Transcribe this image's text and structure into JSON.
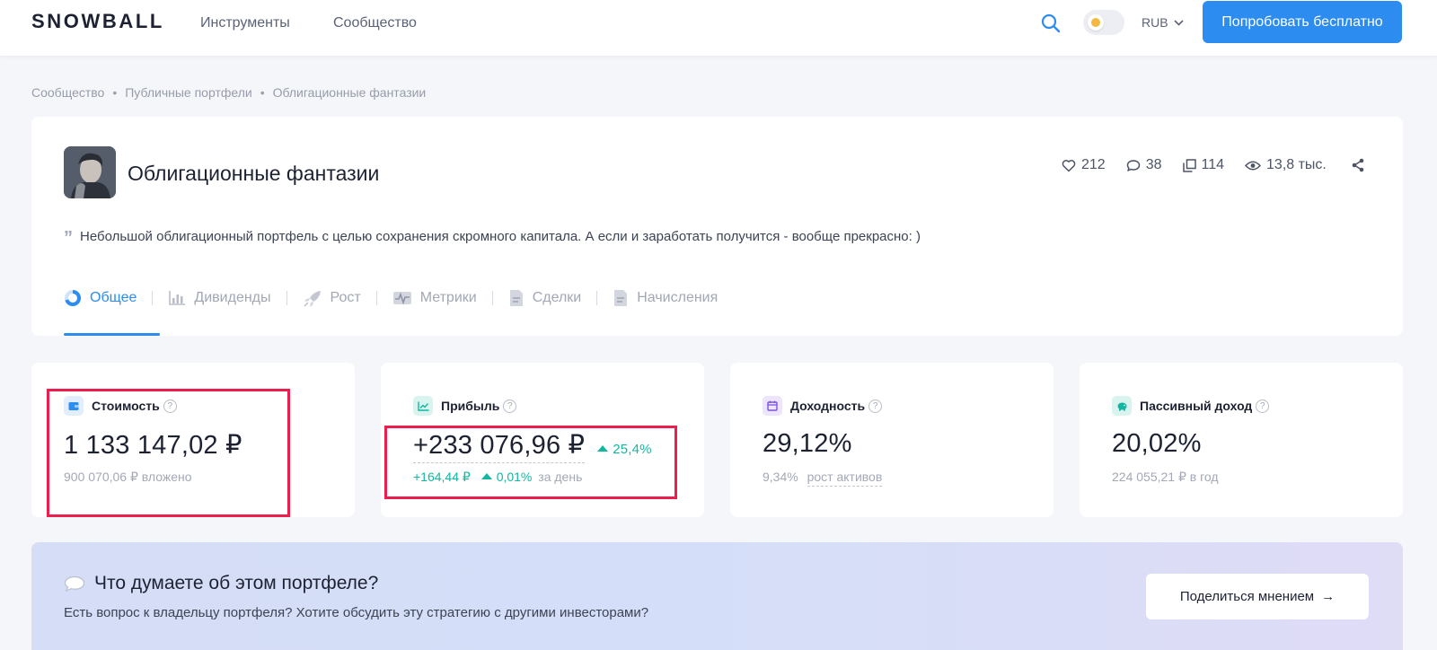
{
  "header": {
    "logo": "SNOWBALL",
    "nav": [
      "Инструменты",
      "Сообщество"
    ],
    "currency": "RUB",
    "cta": "Попробовать бесплатно"
  },
  "breadcrumb": [
    "Сообщество",
    "Публичные портфели",
    "Облигационные фантазии"
  ],
  "portfolio": {
    "title": "Облигационные фантазии",
    "description": "Небольшой облигационный портфель с целью сохранения скромного капитала. А если и заработать получится - вообще прекрасно: )",
    "stats": {
      "likes": "212",
      "comments": "38",
      "copies": "114",
      "views": "13,8 тыс."
    },
    "tabs": [
      "Общее",
      "Дивиденды",
      "Рост",
      "Метрики",
      "Сделки",
      "Начисления"
    ]
  },
  "metrics": {
    "cost": {
      "label": "Стоимость",
      "value": "1 133 147,02 ₽",
      "sub": "900 070,06 ₽ вложено"
    },
    "profit": {
      "label": "Прибыль",
      "value": "+233 076,96 ₽",
      "change": "25,4%",
      "day_value": "+164,44 ₽",
      "day_change": "0,01%",
      "day_label": "за день"
    },
    "yield": {
      "label": "Доходность",
      "value": "29,12%",
      "sub_value": "9,34%",
      "sub_label": "рост активов"
    },
    "passive": {
      "label": "Пассивный доход",
      "value": "20,02%",
      "sub": "224 055,21 ₽ в год"
    }
  },
  "banner": {
    "title": "Что думаете об этом портфеле?",
    "subtitle": "Есть вопрос к владельцу портфеля? Хотите обсудить эту стратегию с другими инвесторами?",
    "button": "Поделиться мнением",
    "button_arrow": "→"
  },
  "colors": {
    "accent": "#2d8cf0",
    "positive": "#13b6a0",
    "highlight": "#ec1e4e"
  }
}
